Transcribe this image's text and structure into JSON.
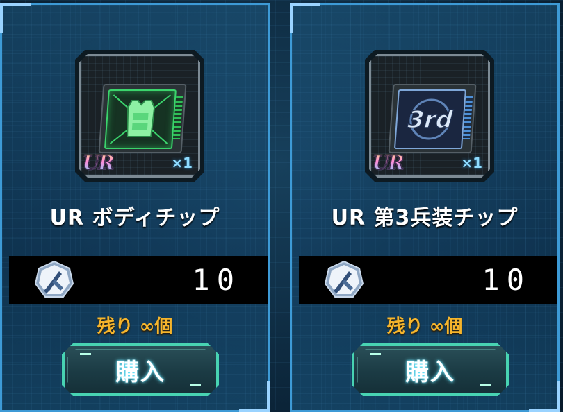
{
  "shop": {
    "items": [
      {
        "rarity_badge": "UR",
        "quantity": "×1",
        "name": "UR ボディチップ",
        "price": "10",
        "stock": "残り ∞個",
        "buy_label": "購入",
        "chip_style": "green",
        "chip_text": ""
      },
      {
        "rarity_badge": "UR",
        "quantity": "×1",
        "name": "UR 第3兵装チップ",
        "price": "10",
        "stock": "残り ∞個",
        "buy_label": "購入",
        "chip_style": "blue",
        "chip_text": "3rd"
      }
    ],
    "currency_icon": "sword-medal-icon"
  },
  "colors": {
    "card_border": "#3d9ad6",
    "stock_text": "#f6b52c",
    "button_border": "#48d3b2",
    "price_bar": "#000000"
  }
}
